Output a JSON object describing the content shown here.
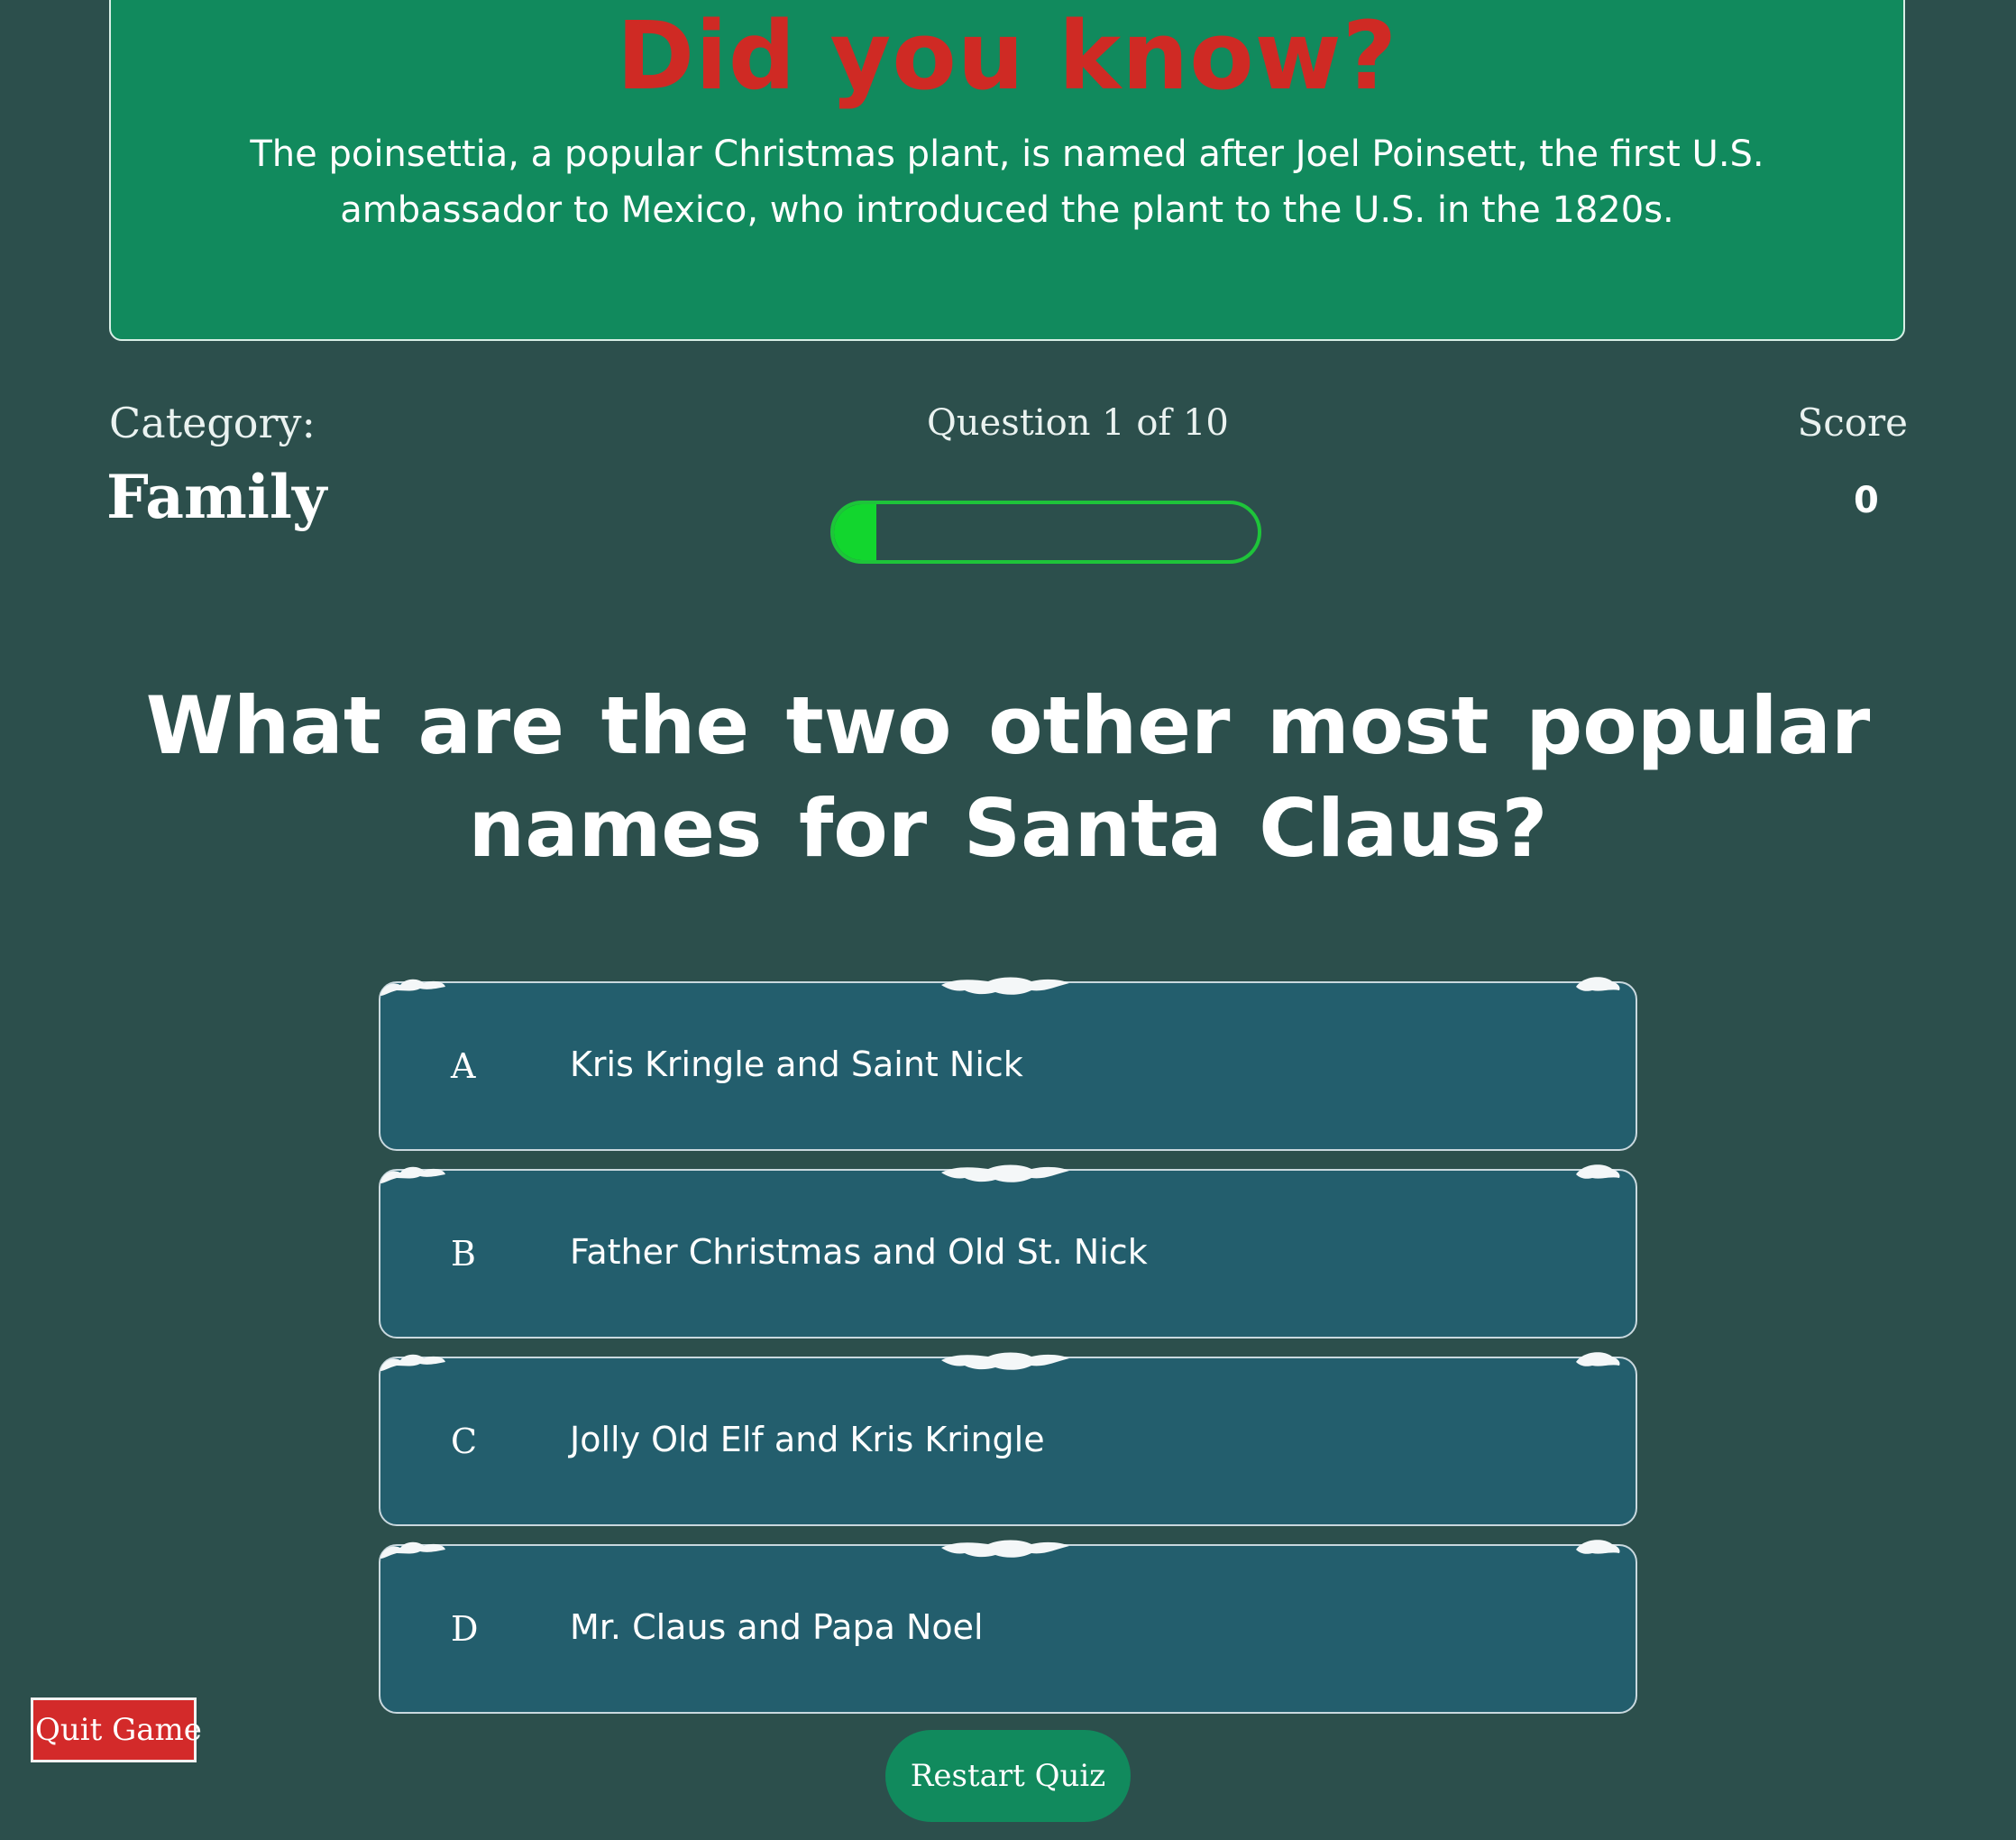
{
  "fact": {
    "title": "Did you know?",
    "text": "The poinsettia, a popular Christmas plant, is named after Joel Poinsett, the first U.S. ambassador to Mexico, who introduced the plant to the U.S. in the 1820s."
  },
  "status": {
    "category_label": "Category:",
    "category_value": "Family",
    "question_counter": "Question 1 of 10",
    "progress_fraction": 0.1,
    "score_label": "Score",
    "score_value": "0"
  },
  "question": {
    "text": "What are the two other most popular names for Santa Claus?"
  },
  "answers": [
    {
      "letter": "A",
      "text": "Kris Kringle and Saint Nick"
    },
    {
      "letter": "B",
      "text": "Father Christmas and Old St. Nick"
    },
    {
      "letter": "C",
      "text": "Jolly Old Elf and Kris Kringle"
    },
    {
      "letter": "D",
      "text": "Mr. Claus and Papa Noel"
    }
  ],
  "buttons": {
    "quit": "Quit Game",
    "restart": "Restart Quiz"
  },
  "colors": {
    "background": "#2c4f4c",
    "fact_box": "#118a5d",
    "fact_title": "#cf2a24",
    "progress": "#12d62e",
    "answer_bg": "#235e6d",
    "quit_bg": "#d32a2a",
    "restart_bg": "#118a5d"
  }
}
